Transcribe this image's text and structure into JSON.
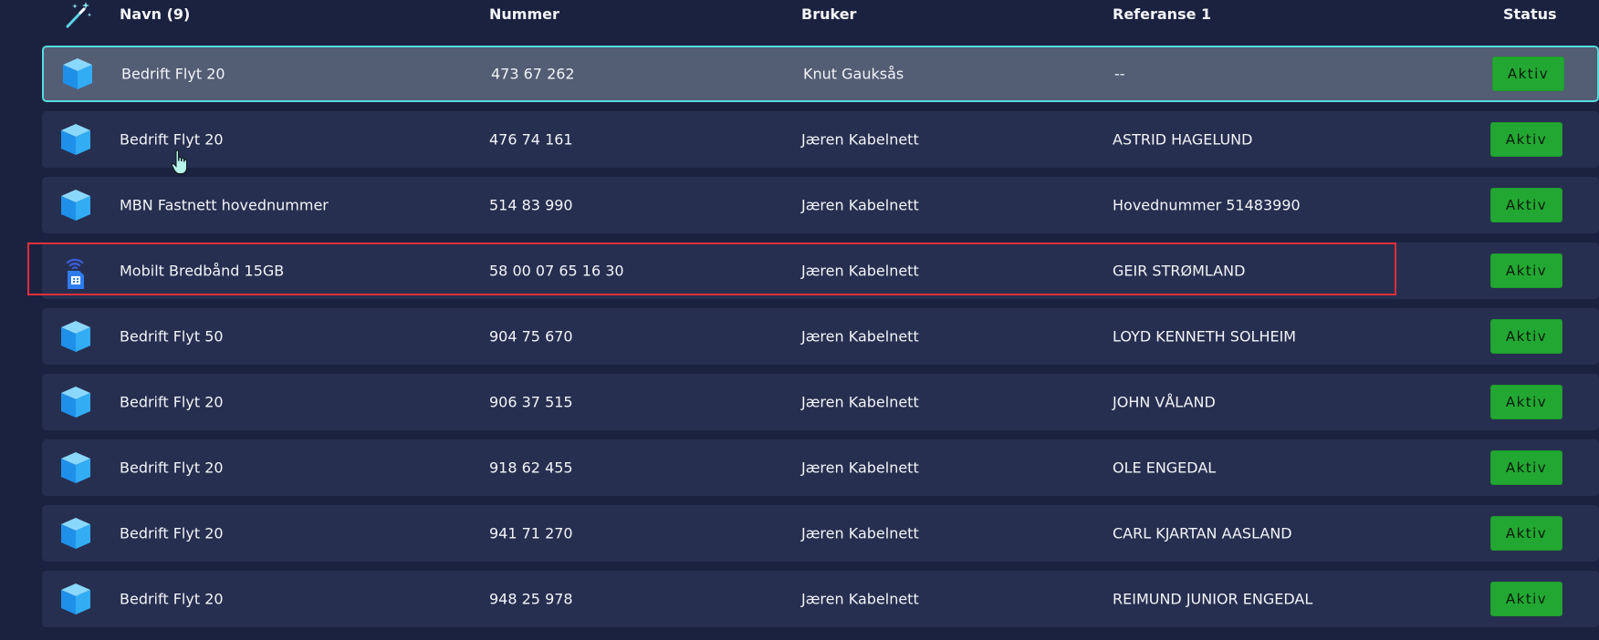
{
  "header": {
    "name_label": "Navn (9)",
    "number_label": "Nummer",
    "user_label": "Bruker",
    "reference_label": "Referanse 1",
    "status_label": "Status",
    "wand_icon": "magic-wand-icon"
  },
  "rows": [
    {
      "icon": "cube-icon",
      "name": "Bedrift Flyt 20",
      "number": "473 67 262",
      "user": "Knut Gauksås",
      "reference": "--",
      "status": "Aktiv",
      "selected": true
    },
    {
      "icon": "cube-icon",
      "name": "Bedrift Flyt 20",
      "number": "476 74 161",
      "user": "Jæren Kabelnett",
      "reference": "ASTRID HAGELUND",
      "status": "Aktiv"
    },
    {
      "icon": "cube-icon",
      "name": "MBN Fastnett hovednummer",
      "number": "514 83 990",
      "user": "Jæren Kabelnett",
      "reference": "Hovednummer 51483990",
      "status": "Aktiv"
    },
    {
      "icon": "sim-card-wireless-icon",
      "name": "Mobilt Bredbånd 15GB",
      "number": "58 00 07 65 16 30",
      "user": "Jæren Kabelnett",
      "reference": "GEIR STRØMLAND",
      "status": "Aktiv",
      "highlighted": true
    },
    {
      "icon": "cube-icon",
      "name": "Bedrift Flyt 50",
      "number": "904 75 670",
      "user": "Jæren Kabelnett",
      "reference": "LOYD KENNETH SOLHEIM",
      "status": "Aktiv"
    },
    {
      "icon": "cube-icon",
      "name": "Bedrift Flyt 20",
      "number": "906 37 515",
      "user": "Jæren Kabelnett",
      "reference": "JOHN VÅLAND",
      "status": "Aktiv"
    },
    {
      "icon": "cube-icon",
      "name": "Bedrift Flyt 20",
      "number": "918 62 455",
      "user": "Jæren Kabelnett",
      "reference": "OLE ENGEDAL",
      "status": "Aktiv"
    },
    {
      "icon": "cube-icon",
      "name": "Bedrift Flyt 20",
      "number": "941 71 270",
      "user": "Jæren Kabelnett",
      "reference": "CARL KJARTAN AASLAND",
      "status": "Aktiv"
    },
    {
      "icon": "cube-icon",
      "name": "Bedrift Flyt 20",
      "number": "948 25 978",
      "user": "Jæren Kabelnett",
      "reference": "REIMUND JUNIOR ENGEDAL",
      "status": "Aktiv"
    }
  ],
  "colors": {
    "background": "#1b2240",
    "row": "#272f50",
    "row_selected": "#535d74",
    "selected_border": "#56dcdc",
    "status_green": "#22a832",
    "highlight_red": "#e02f3a"
  }
}
